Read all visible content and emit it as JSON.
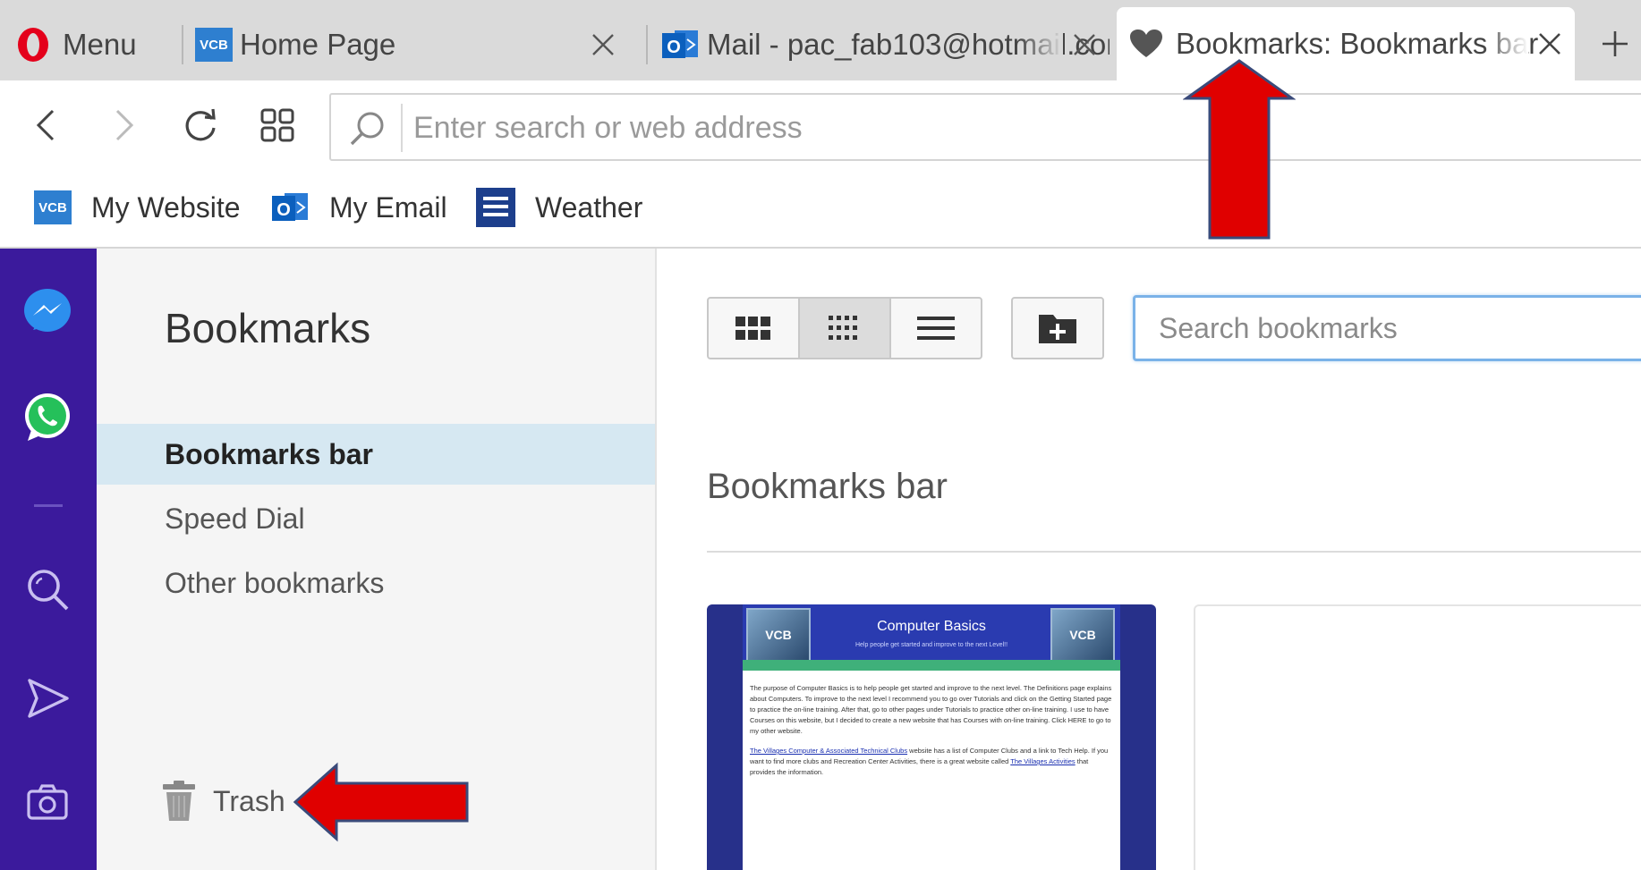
{
  "tabs": {
    "menu": {
      "label": "Menu"
    },
    "home": {
      "label": "Home Page",
      "icon_text": "VCB"
    },
    "mail": {
      "label": "Mail - pac_fab103@hotmail.com"
    },
    "bookmarks": {
      "label": "Bookmarks: Bookmarks bar",
      "active": true
    }
  },
  "address_bar": {
    "placeholder": "Enter search or web address"
  },
  "bookmarks_bar": {
    "items": [
      {
        "label": "My Website",
        "icon": "vcb-icon",
        "icon_text": "VCB"
      },
      {
        "label": "My Email",
        "icon": "outlook-icon"
      },
      {
        "label": "Weather",
        "icon": "weather-channel-icon"
      }
    ]
  },
  "sidebar_rail": {
    "items": [
      "messenger-icon",
      "whatsapp-icon",
      "search-icon",
      "send-icon",
      "camera-icon"
    ],
    "accent": "#3b1a9c"
  },
  "bookmarks_panel": {
    "title": "Bookmarks",
    "folders": [
      {
        "label": "Bookmarks bar",
        "selected": true
      },
      {
        "label": "Speed Dial",
        "selected": false
      },
      {
        "label": "Other bookmarks",
        "selected": false
      }
    ],
    "trash_label": "Trash"
  },
  "main": {
    "search_placeholder": "Search bookmarks",
    "view_modes": [
      "large-grid",
      "small-grid",
      "list"
    ],
    "selected_view": "small-grid",
    "section_title": "Bookmarks bar",
    "thumbnail": {
      "site_title": "Computer Basics",
      "site_subtitle": "Help people get started and improve to the next Level!!",
      "logo_text": "VCB",
      "paragraph1": "The purpose of Computer Basics is to help people get started and improve to the next level. The Definitions page explains about Computers. To improve to the next level I recommend you to go over Tutorials and click on the Getting Started page to practice the on-line training. After that, go to other pages under Tutorials to practice other on-line training. I use to have Courses on this website, but I decided to create a new website that has Courses with on-line training. Click HERE to go to my other website.",
      "paragraph2_link": "The Villages Computer & Associated Technical Clubs",
      "paragraph2": " website has a list of Computer Clubs and a link to Tech Help. If you want to find more clubs and Recreation Center Activities, there is a great website called ",
      "paragraph2_link2": "The Villages Activities",
      "paragraph2_end": " that provides the information."
    }
  },
  "colors": {
    "annotation_arrow": "#e00000",
    "selected_folder_bg": "#d6e8f2",
    "opera_red": "#e4001b"
  }
}
